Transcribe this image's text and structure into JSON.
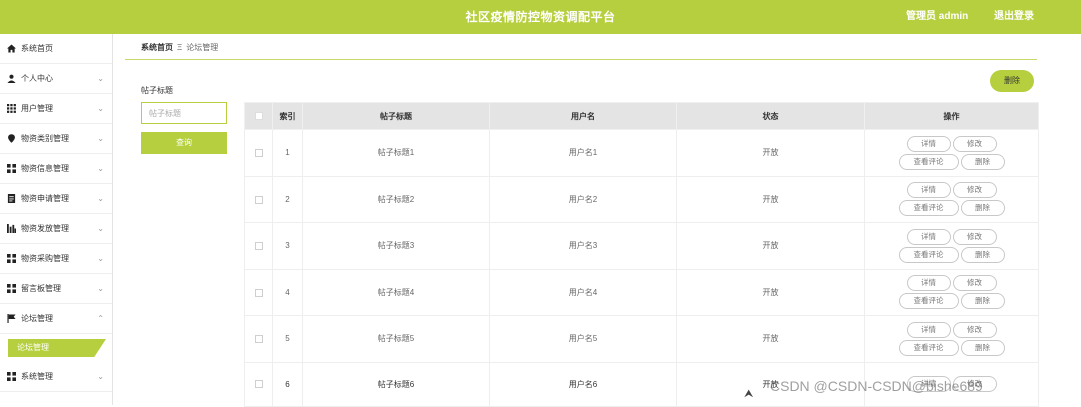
{
  "header": {
    "title": "社区疫情防控物资调配平台",
    "admin_label": "管理员 admin",
    "logout_label": "退出登录"
  },
  "sidebar": {
    "items": [
      {
        "label": "系统首页",
        "icon": "home-icon"
      },
      {
        "label": "个人中心",
        "icon": "user-icon"
      },
      {
        "label": "用户管理",
        "icon": "grid-icon"
      },
      {
        "label": "物资类别管理",
        "icon": "location-icon"
      },
      {
        "label": "物资信息管理",
        "icon": "apps-icon"
      },
      {
        "label": "物资申请管理",
        "icon": "document-icon"
      },
      {
        "label": "物资发放管理",
        "icon": "bar-chart-icon"
      },
      {
        "label": "物资采购管理",
        "icon": "apps-icon"
      },
      {
        "label": "留言板管理",
        "icon": "apps-icon"
      },
      {
        "label": "论坛管理",
        "icon": "flag-icon"
      }
    ],
    "active_sub": "论坛管理",
    "system_item": "系统管理"
  },
  "breadcrumb": {
    "home": "系统首页",
    "separator": "Ξ",
    "current": "论坛管理"
  },
  "filter": {
    "label": "帖子标题",
    "placeholder": "帖子标题",
    "query_button": "查询"
  },
  "toolbar": {
    "delete_label": "删除"
  },
  "table": {
    "headers": [
      "索引",
      "帖子标题",
      "用户名",
      "状态",
      "操作"
    ],
    "rows": [
      {
        "index": "1",
        "title": "帖子标题1",
        "username": "用户名1",
        "status": "开放"
      },
      {
        "index": "2",
        "title": "帖子标题2",
        "username": "用户名2",
        "status": "开放"
      },
      {
        "index": "3",
        "title": "帖子标题3",
        "username": "用户名3",
        "status": "开放"
      },
      {
        "index": "4",
        "title": "帖子标题4",
        "username": "用户名4",
        "status": "开放"
      },
      {
        "index": "5",
        "title": "帖子标题5",
        "username": "用户名5",
        "status": "开放"
      },
      {
        "index": "6",
        "title": "帖子标题6",
        "username": "用户名6",
        "status": "开放"
      }
    ],
    "actions": {
      "detail": "详情",
      "edit": "修改",
      "view_comments": "查看评论",
      "delete": "删除"
    }
  },
  "watermark": "CSDN @CSDN-CSDN@bishe689",
  "colors": {
    "accent": "#b6cf3f",
    "table_header": "#e4e4e4"
  }
}
